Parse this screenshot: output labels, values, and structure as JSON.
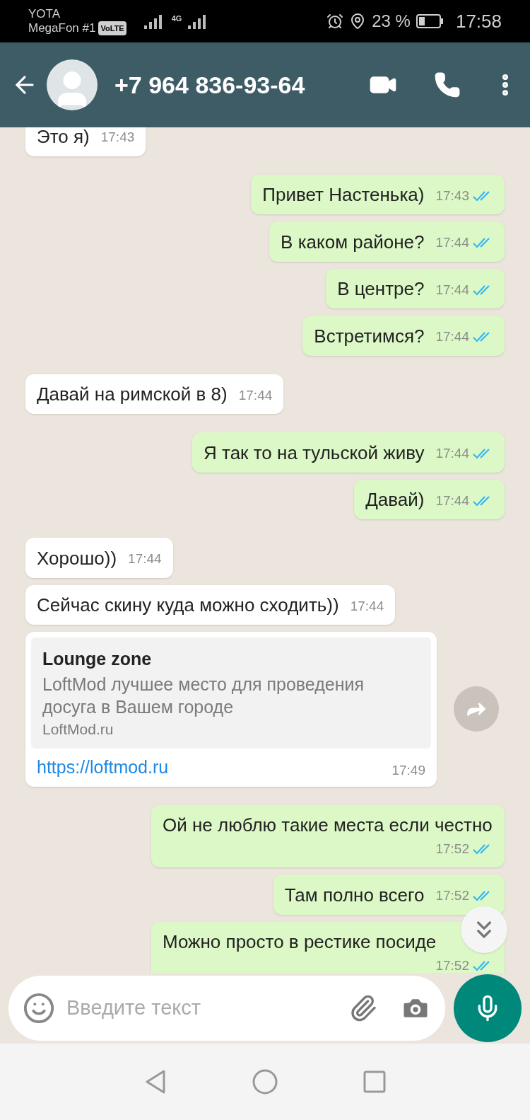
{
  "status_bar": {
    "carrier_1": "YOTA",
    "carrier_2": "MegaFon #1",
    "volte": "VoLTE",
    "network": "4G",
    "battery": "23 %",
    "time": "17:58"
  },
  "header": {
    "title": "+7 964 836-93-64"
  },
  "messages": [
    {
      "kind": "text",
      "outgoing": false,
      "text": "Это я)",
      "time": "17:43"
    },
    {
      "kind": "text",
      "outgoing": true,
      "text": "Привет Настенька)",
      "time": "17:43",
      "read": true
    },
    {
      "kind": "text",
      "outgoing": true,
      "text": "В каком районе?",
      "time": "17:44",
      "read": true
    },
    {
      "kind": "text",
      "outgoing": true,
      "text": "В центре?",
      "time": "17:44",
      "read": true
    },
    {
      "kind": "text",
      "outgoing": true,
      "text": "Встретимся?",
      "time": "17:44",
      "read": true
    },
    {
      "kind": "text",
      "outgoing": false,
      "text": "Давай на римской в 8)",
      "time": "17:44"
    },
    {
      "kind": "text",
      "outgoing": true,
      "text": "Я так то на тульской живу",
      "time": "17:44",
      "read": true
    },
    {
      "kind": "text",
      "outgoing": true,
      "text": "Давай)",
      "time": "17:44",
      "read": true
    },
    {
      "kind": "text",
      "outgoing": false,
      "text": "Хорошо))",
      "time": "17:44"
    },
    {
      "kind": "text",
      "outgoing": false,
      "text": "Сейчас скину куда можно сходить))",
      "time": "17:44"
    },
    {
      "kind": "link",
      "outgoing": false,
      "title": "Lounge zone",
      "description": "LoftMod лучшее место для проведения досуга в Вашем городе",
      "domain": "LoftMod.ru",
      "url": "https://loftmod.ru",
      "time": "17:49"
    },
    {
      "kind": "text",
      "outgoing": true,
      "text": "Ой не люблю такие места если честно",
      "time": "17:52",
      "read": true
    },
    {
      "kind": "text",
      "outgoing": true,
      "text": "Там полно всего",
      "time": "17:52",
      "read": true
    },
    {
      "kind": "text",
      "outgoing": true,
      "text": "Можно просто в рестике посиде",
      "time": "17:52",
      "read": true
    }
  ],
  "composer": {
    "placeholder": "Введите текст"
  }
}
